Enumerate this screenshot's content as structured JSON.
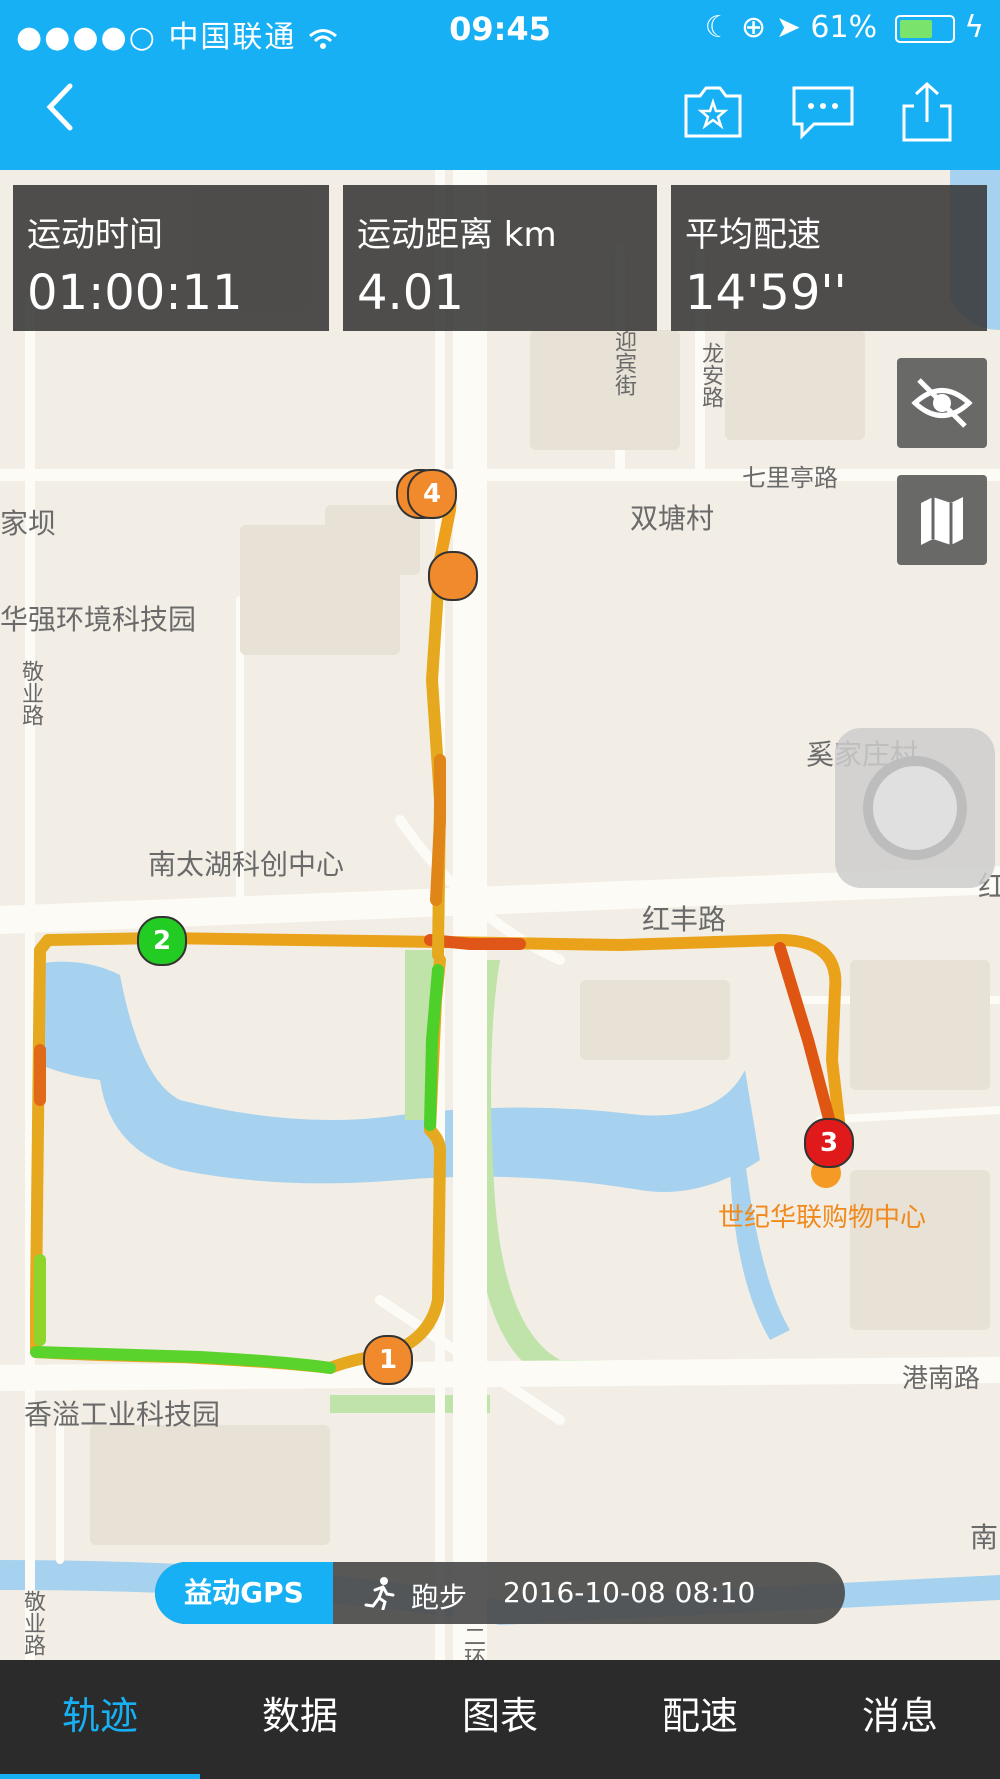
{
  "status_bar": {
    "signal": "●●●●○",
    "carrier": "中国联通",
    "time": "09:45",
    "battery": "61%"
  },
  "nav": {
    "icons": [
      "back-icon",
      "camera-star-icon",
      "comment-icon",
      "share-icon"
    ]
  },
  "stats": [
    {
      "label": "运动时间",
      "value": "01:00:11"
    },
    {
      "label": "运动距离 km",
      "value": "4.01"
    },
    {
      "label": "平均配速",
      "value": "14'59''"
    }
  ],
  "map": {
    "labels": {
      "qiliting": "七里亭路",
      "shuangtang": "双塘村",
      "huaqiang": "华强环境科技园",
      "jingye": "敬业路",
      "jingye2": "敬业路",
      "xijia": "奚家庄村",
      "nantaihu": "南太湖科创中心",
      "hongfeng": "红丰路",
      "shijihualian": "世纪华联购物中心",
      "gangnan": "港南路",
      "xiangyi": "香溢工业科技园",
      "yingbin": "迎宾街",
      "longan": "龙安路",
      "ba": "家坝",
      "nan": "南",
      "hong": "红",
      "ring": "二环"
    },
    "markers": [
      "1",
      "2",
      "3",
      "4"
    ]
  },
  "gps_bar": {
    "brand": "益动GPS",
    "activity_type": "跑步",
    "datetime": "2016-10-08 08:10"
  },
  "tabs": [
    "轨迹",
    "数据",
    "图表",
    "配速",
    "消息"
  ],
  "active_tab": "轨迹",
  "colors": {
    "accent": "#17b0f4",
    "track_fast": "#3fcf2a",
    "track_mid": "#f0a020",
    "track_slow": "#e04a10"
  }
}
